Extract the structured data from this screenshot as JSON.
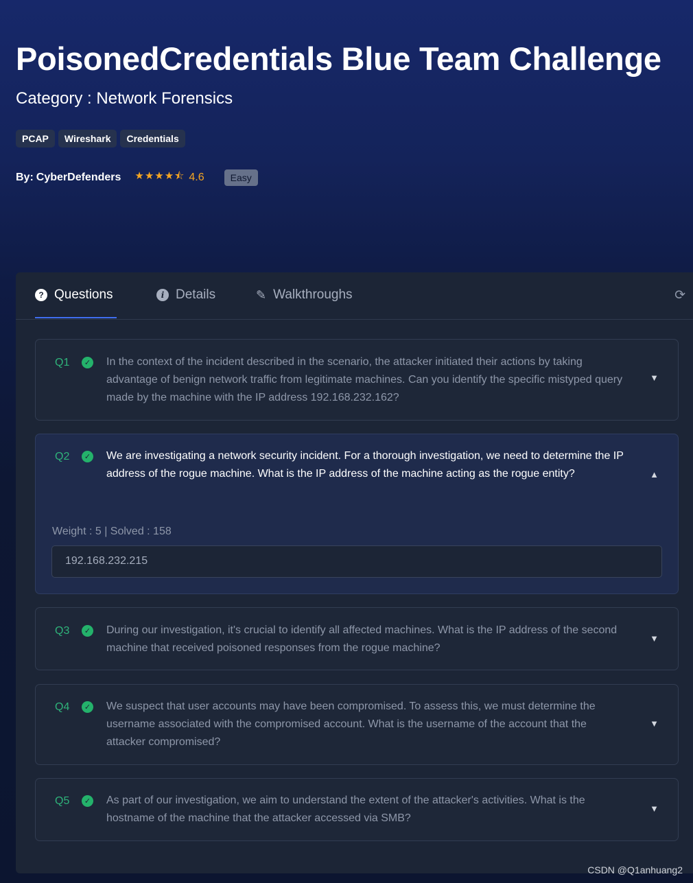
{
  "header": {
    "title": "PoisonedCredentials Blue Team Challenge",
    "category": "Category : Network Forensics",
    "tags": [
      "PCAP",
      "Wireshark",
      "Credentials"
    ],
    "by_label": "By:",
    "author": "CyberDefenders",
    "stars": "★★★★⯪",
    "rating": "4.6",
    "difficulty": "Easy"
  },
  "tabs": [
    {
      "label": "Questions",
      "icon": "question-circle-icon",
      "active": true
    },
    {
      "label": "Details",
      "icon": "info-circle-icon",
      "active": false
    },
    {
      "label": "Walkthroughs",
      "icon": "feather-pen-icon",
      "active": false
    }
  ],
  "questions": [
    {
      "num": "Q1",
      "text": "In the context of the incident described in the scenario, the attacker initiated their actions by taking advantage of benign network traffic from legitimate machines. Can you identify the specific mistyped query made by the machine with the IP address 192.168.232.162?",
      "expanded": false
    },
    {
      "num": "Q2",
      "text": "We are investigating a network security incident. For a thorough investigation, we need to determine the IP address of the rogue machine. What is the IP address of the machine acting as the rogue entity?",
      "expanded": true,
      "meta": "Weight : 5 | Solved : 158",
      "answer": "192.168.232.215"
    },
    {
      "num": "Q3",
      "text": "During our investigation, it's crucial to identify all affected machines. What is the IP address of the second machine that received poisoned responses from the rogue machine?",
      "expanded": false
    },
    {
      "num": "Q4",
      "text": "We suspect that user accounts may have been compromised. To assess this, we must determine the username associated with the compromised account. What is the username of the account that the attacker compromised?",
      "expanded": false
    },
    {
      "num": "Q5",
      "text": "As part of our investigation, we aim to understand the extent of the attacker's activities. What is the hostname of the machine that the attacker accessed via SMB?",
      "expanded": false
    }
  ],
  "watermark": "CSDN @Q1anhuang2",
  "colors": {
    "accent": "#3f6ef0",
    "success": "#24b26b",
    "rating": "#f6a622"
  }
}
